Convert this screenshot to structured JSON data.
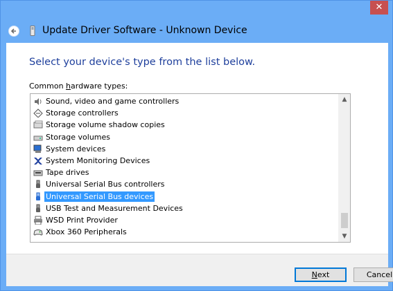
{
  "window": {
    "close_glyph": "✕",
    "back_icon": "back-arrow-icon",
    "title": "Update Driver Software - Unknown Device"
  },
  "main": {
    "instruction": "Select your device's type from the list below.",
    "list_label_pre": "Common ",
    "list_label_accel": "h",
    "list_label_post": "ardware types:"
  },
  "list": {
    "items": [
      {
        "label": "Sound, video and game controllers",
        "icon": "speaker-icon"
      },
      {
        "label": "Storage controllers",
        "icon": "storage-controller-icon"
      },
      {
        "label": "Storage volume shadow copies",
        "icon": "shadow-copy-icon"
      },
      {
        "label": "Storage volumes",
        "icon": "drive-icon"
      },
      {
        "label": "System devices",
        "icon": "computer-icon"
      },
      {
        "label": "System Monitoring Devices",
        "icon": "monitoring-icon"
      },
      {
        "label": "Tape drives",
        "icon": "tape-drive-icon"
      },
      {
        "label": "Universal Serial Bus controllers",
        "icon": "usb-icon"
      },
      {
        "label": "Universal Serial Bus devices",
        "icon": "usb-device-icon",
        "selected": true
      },
      {
        "label": "USB Test and Measurement Devices",
        "icon": "usb-icon"
      },
      {
        "label": "WSD Print Provider",
        "icon": "printer-icon"
      },
      {
        "label": "Xbox 360 Peripherals",
        "icon": "gamepad-icon"
      }
    ],
    "scroll_up": "▲",
    "scroll_down": "▼"
  },
  "buttons": {
    "next_accel": "N",
    "next_rest": "ext",
    "cancel": "Cancel"
  },
  "colors": {
    "frame": "#6badf6",
    "instruction": "#1e3f9c",
    "selection": "#3399ff"
  }
}
